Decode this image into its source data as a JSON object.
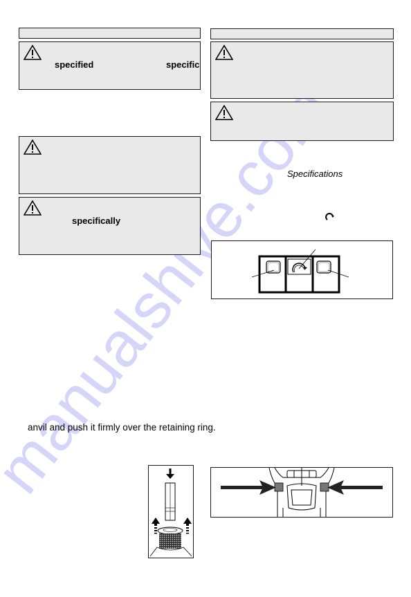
{
  "watermark": {
    "text": "manualshive.com",
    "color": "#c8c8f8"
  },
  "left_column": {
    "warning_1": {
      "bold_words": [
        "specified",
        "specific"
      ]
    },
    "warning_2": {
      "bold_words": []
    },
    "warning_3": {
      "bold_words": [
        "specifically"
      ]
    },
    "body_line": "anvil and push it firmly over the retaining ring."
  },
  "right_column": {
    "warning_1": {
      "bold_words": []
    },
    "warning_2": {
      "bold_words": []
    },
    "specifications_ref": "Specifications",
    "rotation_symbol": "clockwise-arrow"
  },
  "figures": {
    "control_panel": {
      "elements": [
        "left-button",
        "center-dial",
        "right-button"
      ],
      "callouts": 3
    },
    "bit_insertion": {
      "elements": [
        "down-arrow",
        "hex-bit",
        "up-arrows",
        "chuck-collar"
      ]
    },
    "tool_top_view": {
      "elements": [
        "left-arrow",
        "right-arrow",
        "left-release-button",
        "right-release-button"
      ]
    }
  },
  "colors": {
    "box_fill": "#e9e9e9",
    "border": "#1a1a1a",
    "text": "#000000"
  }
}
